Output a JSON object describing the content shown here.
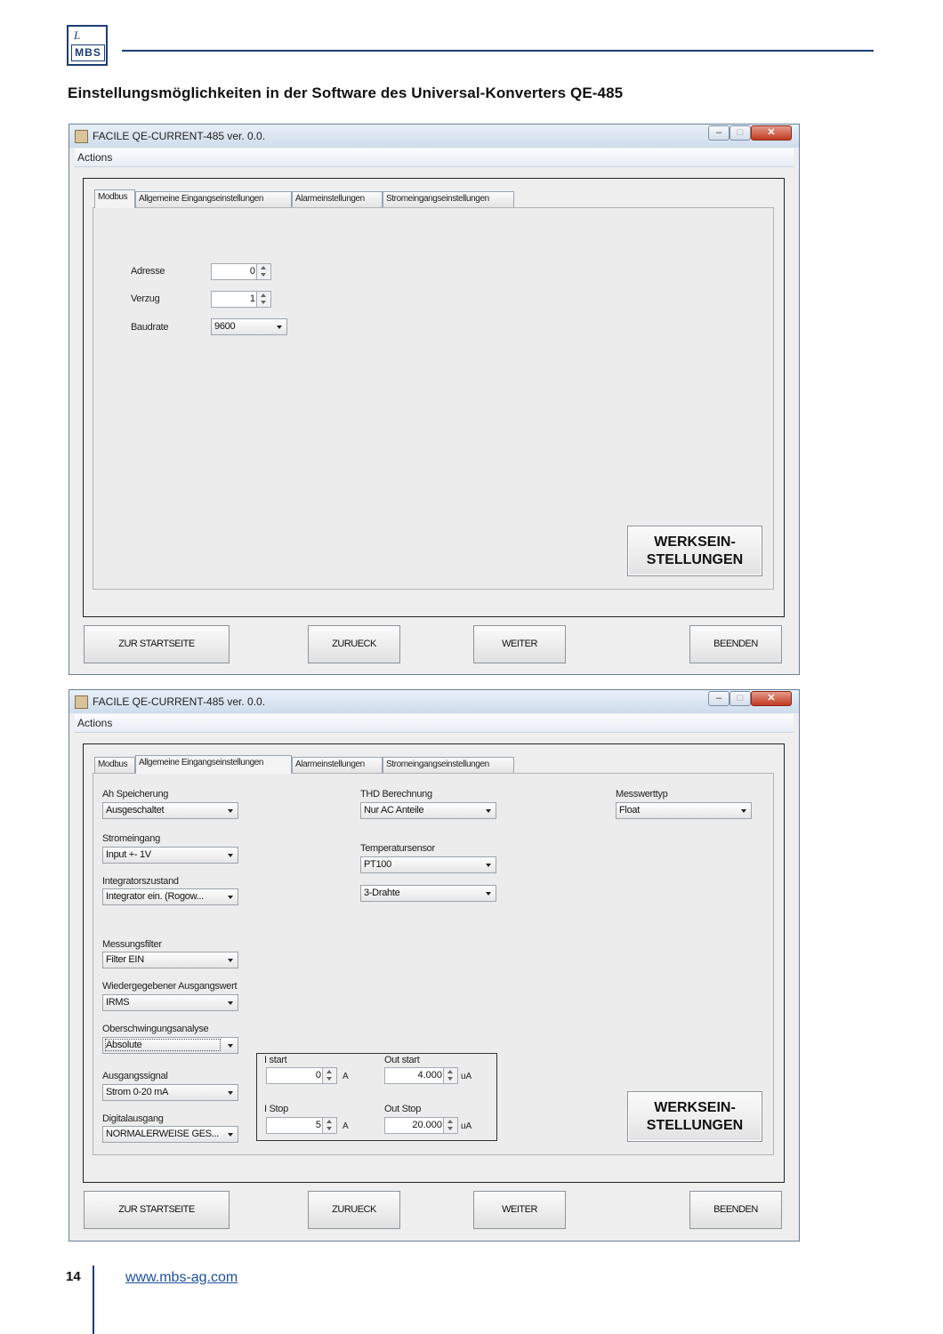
{
  "header": {
    "logo_top": "L",
    "logo_bottom": "MBS",
    "heading": "Einstellungsmöglichkeiten in der Software des Universal-Konverters QE-485"
  },
  "window": {
    "title": "FACILE QE-CURRENT-485 ver. 0.0.",
    "menu": "Actions",
    "tabs": [
      "Modbus",
      "Allgemeine Eingangseinstellungen",
      "Alarmeinstellungen",
      "Stromeingangseinstellungen"
    ],
    "buttons": {
      "home": "ZUR STARTSEITE",
      "back": "ZURUECK",
      "next": "WEITER",
      "exit": "BEENDEN",
      "factory_1": "WERKSEIN-",
      "factory_2": "STELLUNGEN"
    }
  },
  "modbus": {
    "adresse_label": "Adresse",
    "adresse_value": "0",
    "verzug_label": "Verzug",
    "verzug_value": "1",
    "baudrate_label": "Baudrate",
    "baudrate_value": "9600"
  },
  "general": {
    "ah_label": "Ah Speicherung",
    "ah_value": "Ausgeschaltet",
    "strom_label": "Stromeingang",
    "strom_value": "Input +- 1V",
    "integ_label": "Integratorszustand",
    "integ_value": "Integrator ein. (Rogow...",
    "filter_label": "Messungsfilter",
    "filter_value": "Filter EIN",
    "wieder_label": "Wiedergegebener Ausgangswert",
    "wieder_value": "IRMS",
    "ober_label": "Oberschwingungsanalyse",
    "ober_value": "Absolute",
    "ausg_label": "Ausgangssignal",
    "ausg_value": "Strom 0-20 mA",
    "digi_label": "Digitalausgang",
    "digi_value": "NORMALERWEISE GES...",
    "thd_label": "THD Berechnung",
    "thd_value": "Nur AC Anteile",
    "temp_label": "Temperatursensor",
    "temp_value": "PT100",
    "wire_value": "3-Drahte",
    "mess_label": "Messwerttyp",
    "mess_value": "Float",
    "istart_label": "I start",
    "istart_value": "0",
    "istart_unit": "A",
    "istop_label": "I Stop",
    "istop_value": "5",
    "istop_unit": "A",
    "outstart_label": "Out start",
    "outstart_value": "4.000",
    "outstart_unit": "uA",
    "outstop_label": "Out Stop",
    "outstop_value": "20.000",
    "outstop_unit": "uA"
  },
  "footer": {
    "page": "14",
    "url": "www.mbs-ag.com"
  }
}
